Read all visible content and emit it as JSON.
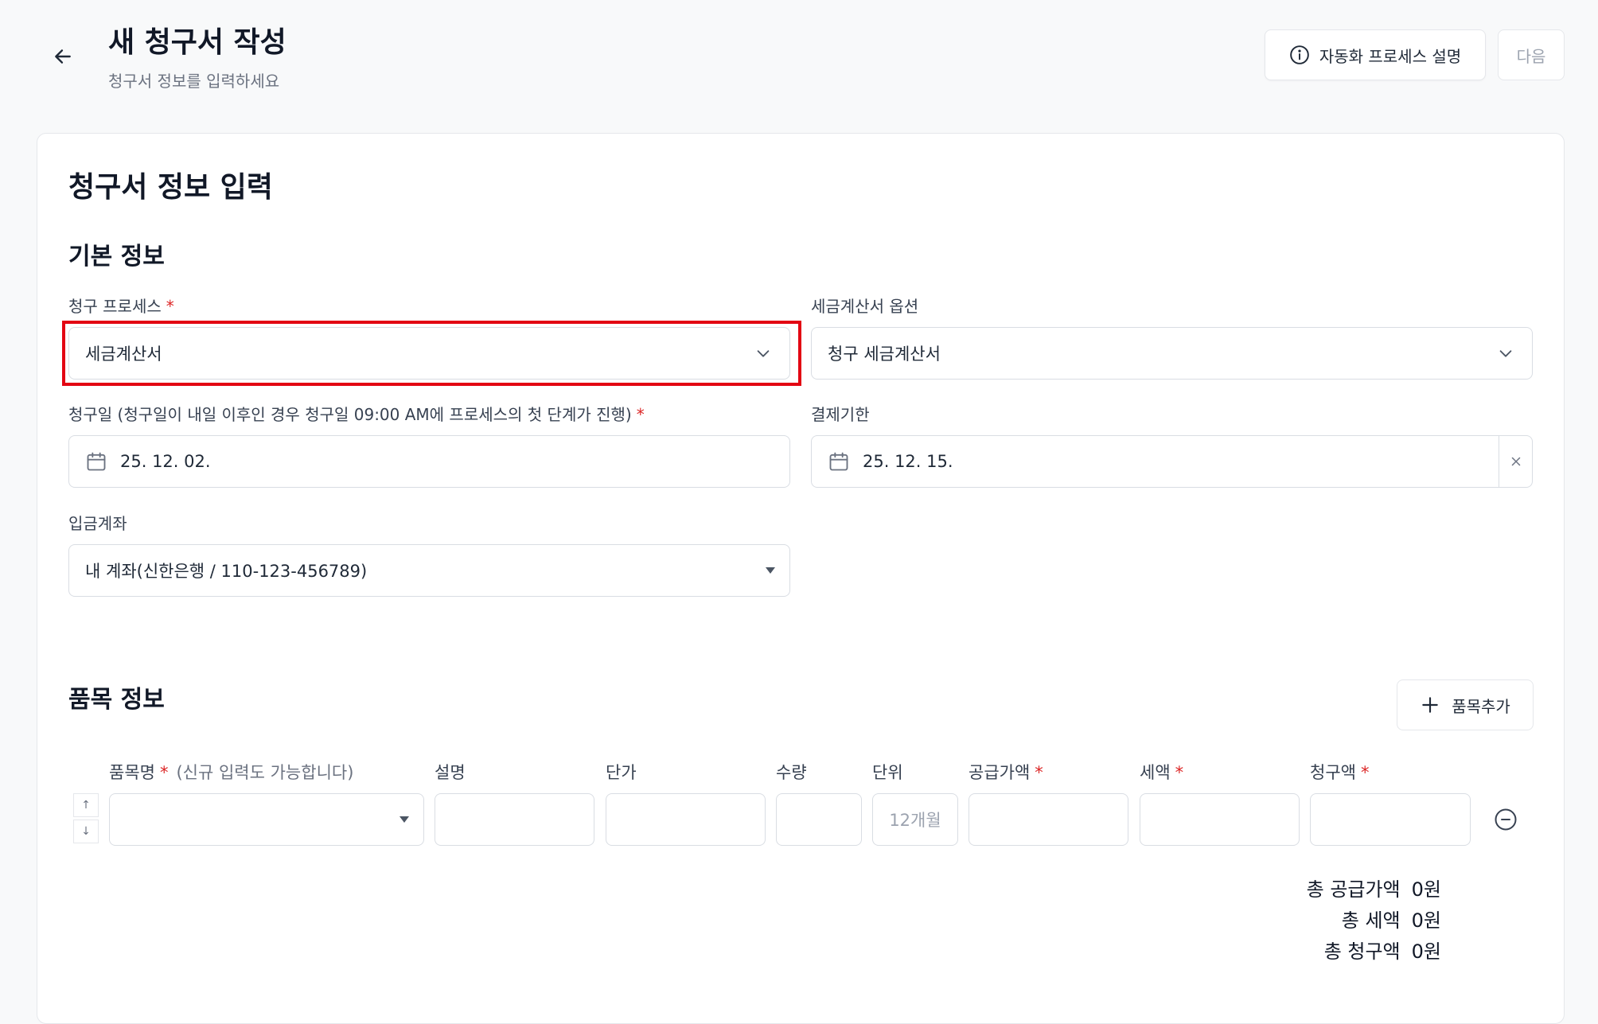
{
  "header": {
    "title": "새 청구서 작성",
    "subtitle": "청구서 정보를 입력하세요",
    "automation_button": "자동화 프로세스 설명",
    "next_button": "다음"
  },
  "form": {
    "title": "청구서 정보 입력",
    "basic_section": "기본 정보",
    "billing_process": {
      "label": "청구 프로세스",
      "required": "*",
      "value": "세금계산서"
    },
    "tax_invoice_option": {
      "label": "세금계산서 옵션",
      "value": "청구 세금계산서"
    },
    "billing_date": {
      "label": "청구일 (청구일이 내일 이후인 경우 청구일 09:00 AM에 프로세스의 첫 단계가 진행)",
      "required": "*",
      "value": "25. 12. 02."
    },
    "due_date": {
      "label": "결제기한",
      "value": "25. 12. 15."
    },
    "deposit_account": {
      "label": "입금계좌",
      "value": "내 계좌(신한은행 / 110-123-456789)"
    }
  },
  "items": {
    "section_title": "품목 정보",
    "add_button": "품목추가",
    "columns": {
      "name": "품목명",
      "name_required": "*",
      "name_hint": "(신규 입력도 가능합니다)",
      "description": "설명",
      "unit_price": "단가",
      "quantity": "수량",
      "unit": "단위",
      "supply_amount": "공급가액",
      "supply_required": "*",
      "tax": "세액",
      "tax_required": "*",
      "billing_amount": "청구액",
      "billing_required": "*"
    },
    "row": {
      "unit_placeholder": "12개월"
    },
    "move_up": "↑",
    "move_down": "↓"
  },
  "totals": {
    "supply_label": "총 공급가액",
    "supply_value": "0원",
    "tax_label": "총 세액",
    "tax_value": "0원",
    "billing_label": "총 청구액",
    "billing_value": "0원"
  },
  "colors": {
    "highlight": "#e30613",
    "required": "#dc2626"
  }
}
